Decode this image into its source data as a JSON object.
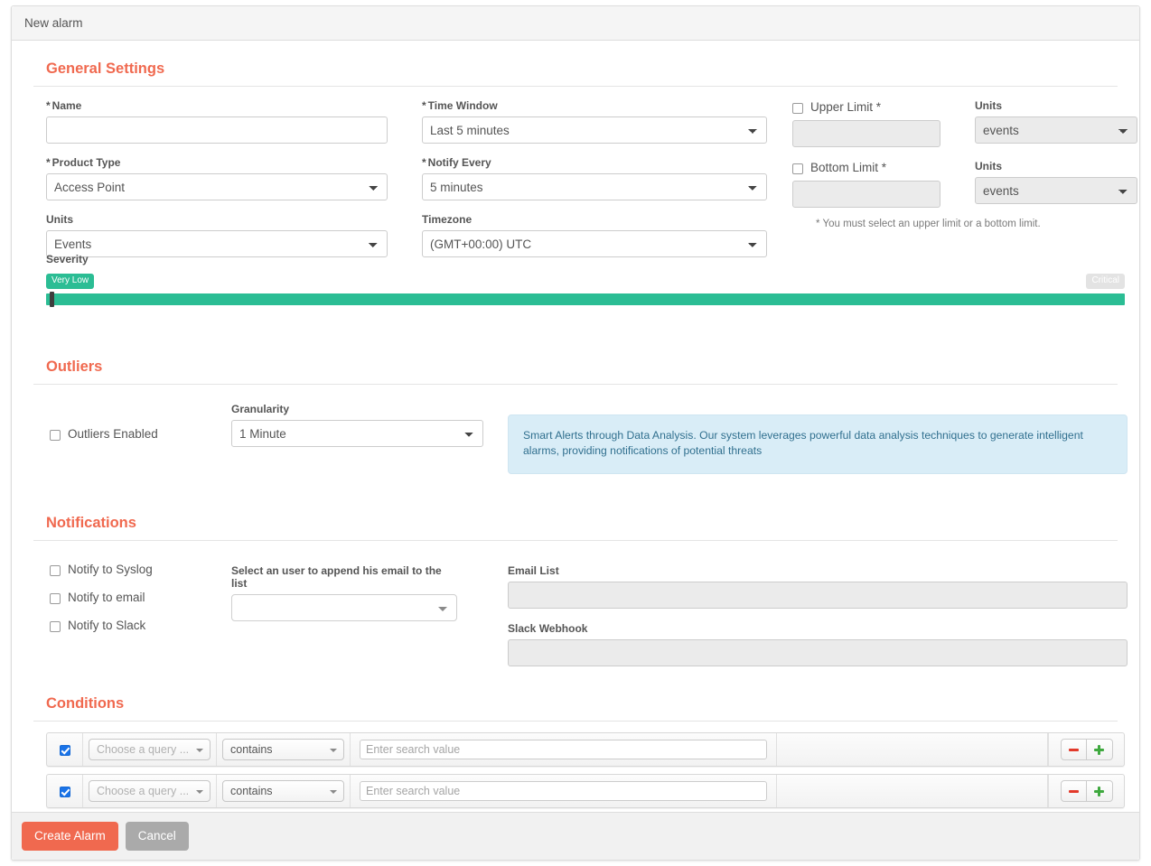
{
  "window": {
    "title": "New alarm"
  },
  "colors": {
    "accent": "#f0694f",
    "severity_low": "#2bbd94",
    "severity_high": "#e3e3e3",
    "info_bg": "#d9edf7",
    "info_text": "#31708f",
    "checkbox_checked": "#1a73e8",
    "minus": "#e2392a",
    "plus": "#3fa93f"
  },
  "general_settings": {
    "heading": "General Settings",
    "name": {
      "label": "Name",
      "required_mark": "*",
      "value": "",
      "placeholder": ""
    },
    "product_type": {
      "label": "Product Type",
      "required_mark": "*",
      "value": "Access Point",
      "options": [
        "Access Point"
      ]
    },
    "units_left": {
      "label": "Units",
      "value": "Events",
      "options": [
        "Events"
      ]
    },
    "time_window": {
      "label": "Time Window",
      "required_mark": "*",
      "value": "Last 5 minutes",
      "options": [
        "Last 5 minutes"
      ]
    },
    "notify_every": {
      "label": "Notify Every",
      "required_mark": "*",
      "value": "5 minutes",
      "options": [
        "5 minutes"
      ]
    },
    "timezone": {
      "label": "Timezone",
      "value": "(GMT+00:00) UTC",
      "options": [
        "(GMT+00:00) UTC"
      ]
    },
    "upper_limit": {
      "label": "Upper Limit *",
      "checked": false,
      "value": "",
      "disabled": true,
      "units_label": "Units",
      "units_value": "events",
      "units_options": [
        "events"
      ]
    },
    "bottom_limit": {
      "label": "Bottom Limit *",
      "checked": false,
      "value": "",
      "disabled": true,
      "units_label": "Units",
      "units_value": "events",
      "units_options": [
        "events"
      ]
    },
    "limit_note": "* You must select an upper limit or a bottom limit.",
    "severity": {
      "label": "Severity",
      "low_badge": "Very Low",
      "high_badge": "Critical",
      "value_percent": 0
    }
  },
  "outliers": {
    "heading": "Outliers",
    "enabled": {
      "label": "Outliers Enabled",
      "checked": false
    },
    "granularity": {
      "label": "Granularity",
      "value": "1 Minute",
      "options": [
        "1 Minute"
      ]
    },
    "info": "Smart Alerts through Data Analysis. Our system leverages powerful data analysis techniques to generate intelligent alarms, providing notifications of potential threats"
  },
  "notifications": {
    "heading": "Notifications",
    "checks": [
      {
        "label": "Notify to Syslog",
        "checked": false
      },
      {
        "label": "Notify to email",
        "checked": false
      },
      {
        "label": "Notify to Slack",
        "checked": false
      }
    ],
    "user_select": {
      "label": "Select an user to append his email to the list",
      "value": "",
      "placeholder": ""
    },
    "email_list": {
      "label": "Email List",
      "value": "",
      "placeholder": "",
      "disabled": true
    },
    "slack_webhook": {
      "label": "Slack Webhook",
      "value": "",
      "placeholder": "",
      "disabled": true
    }
  },
  "conditions": {
    "heading": "Conditions",
    "rows": [
      {
        "enabled": true,
        "query": "Choose a query ...",
        "operator": "contains",
        "value": "",
        "value_placeholder": "Enter search value",
        "remove_label": "−",
        "add_label": "+"
      },
      {
        "enabled": true,
        "query": "Choose a query ...",
        "operator": "contains",
        "value": "",
        "value_placeholder": "Enter search value",
        "remove_label": "−",
        "add_label": "+"
      }
    ]
  },
  "footer": {
    "submit_label": "Create Alarm",
    "cancel_label": "Cancel"
  }
}
